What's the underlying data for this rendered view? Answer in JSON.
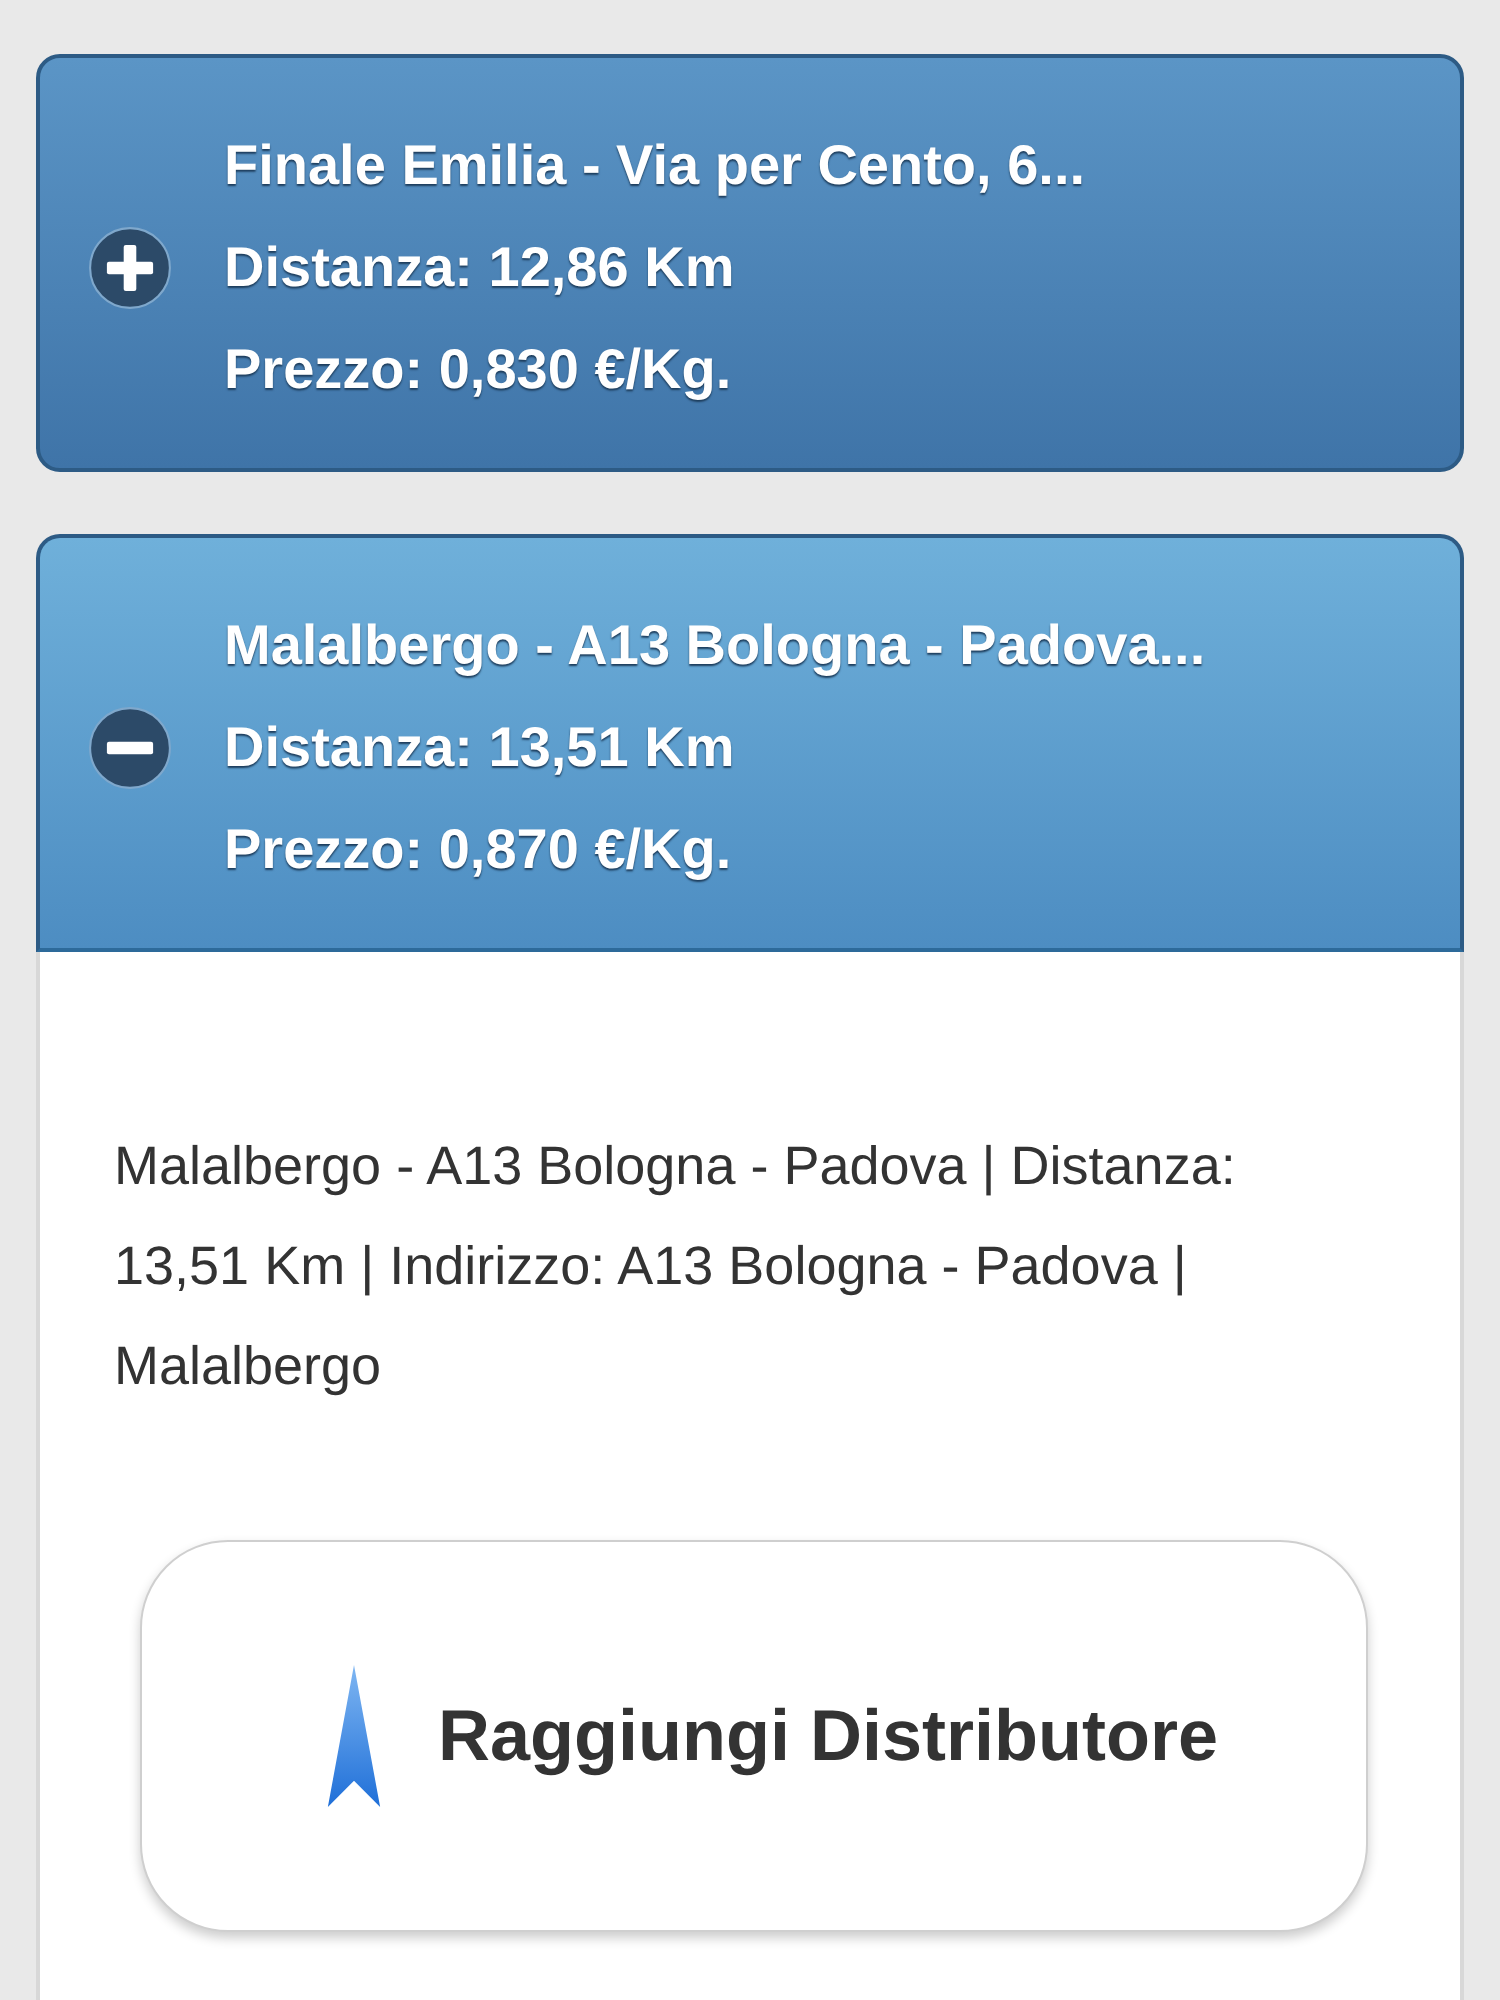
{
  "stations": [
    {
      "name": "Finale Emilia - Via per Cento, 6...",
      "distance": "Distanza: 12,86 Km",
      "price": "Prezzo: 0,830 €/Kg.",
      "expanded": false
    },
    {
      "name": "Malalbergo - A13 Bologna - Padova...",
      "distance": "Distanza: 13,51 Km",
      "price": "Prezzo: 0,870 €/Kg.",
      "expanded": true,
      "details": "Malalbergo - A13 Bologna - Padova | Distanza: 13,51 Km | Indirizzo: A13 Bologna - Padova | Malalbergo",
      "action": "Raggiungi Distributore"
    }
  ]
}
